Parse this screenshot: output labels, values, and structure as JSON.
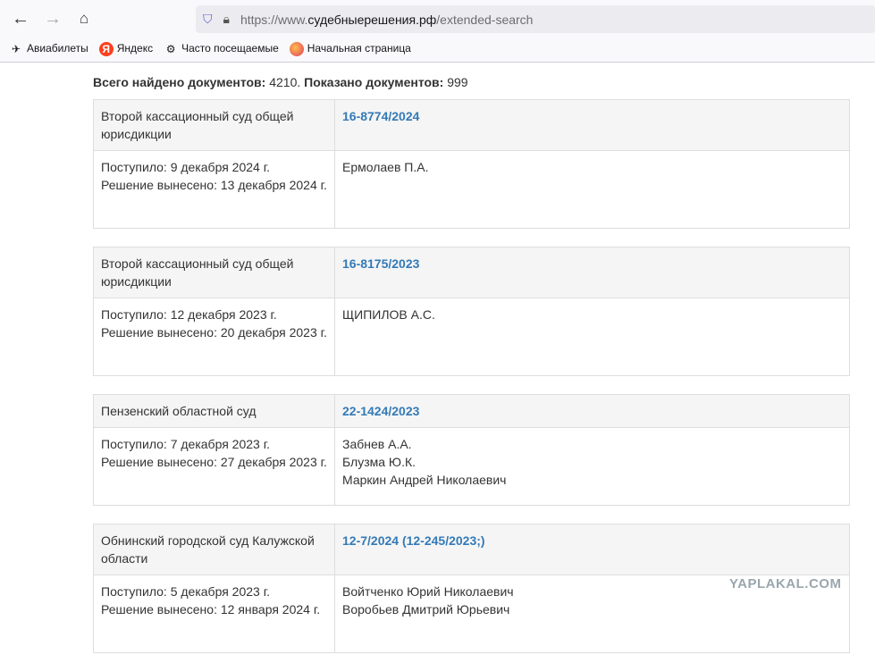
{
  "browser": {
    "url_prefix": "https://www.",
    "url_domain": "судебныерешения.рф",
    "url_path": "/extended-search",
    "bookmarks": [
      "Авиабилеты",
      "Яндекс",
      "Часто посещаемые",
      "Начальная страница"
    ]
  },
  "summary": {
    "found_label": "Всего найдено документов:",
    "found": "4210.",
    "shown_label": "Показано документов:",
    "shown": "999"
  },
  "results": [
    {
      "court": "Второй кассационный суд общей юрисдикции",
      "case": "16-8774/2024",
      "received": "Поступило: 9 декабря 2024 г.",
      "decided": "Решение вынесено: 13 декабря 2024 г.",
      "judges": [
        "Ермолаев П.А."
      ]
    },
    {
      "court": "Второй кассационный суд общей юрисдикции",
      "case": "16-8175/2023",
      "received": "Поступило: 12 декабря 2023 г.",
      "decided": "Решение вынесено: 20 декабря 2023 г.",
      "judges": [
        "ЩИПИЛОВ А.С."
      ]
    },
    {
      "court": "Пензенский областной суд",
      "case": "22-1424/2023",
      "received": "Поступило: 7 декабря 2023 г.",
      "decided": "Решение вынесено: 27 декабря 2023 г.",
      "judges": [
        "Забнев А.А.",
        "Блузма Ю.К.",
        "Маркин Андрей Николаевич"
      ]
    },
    {
      "court": "Обнинский городской суд Калужской области",
      "case": "12-7/2024 (12-245/2023;)",
      "received": "Поступило: 5 декабря 2023 г.",
      "decided": "Решение вынесено: 12 января 2024 г.",
      "judges": [
        "Войтченко Юрий Николаевич",
        "Воробьев Дмитрий Юрьевич"
      ]
    }
  ],
  "watermark": "YAPLAKAL.COM"
}
